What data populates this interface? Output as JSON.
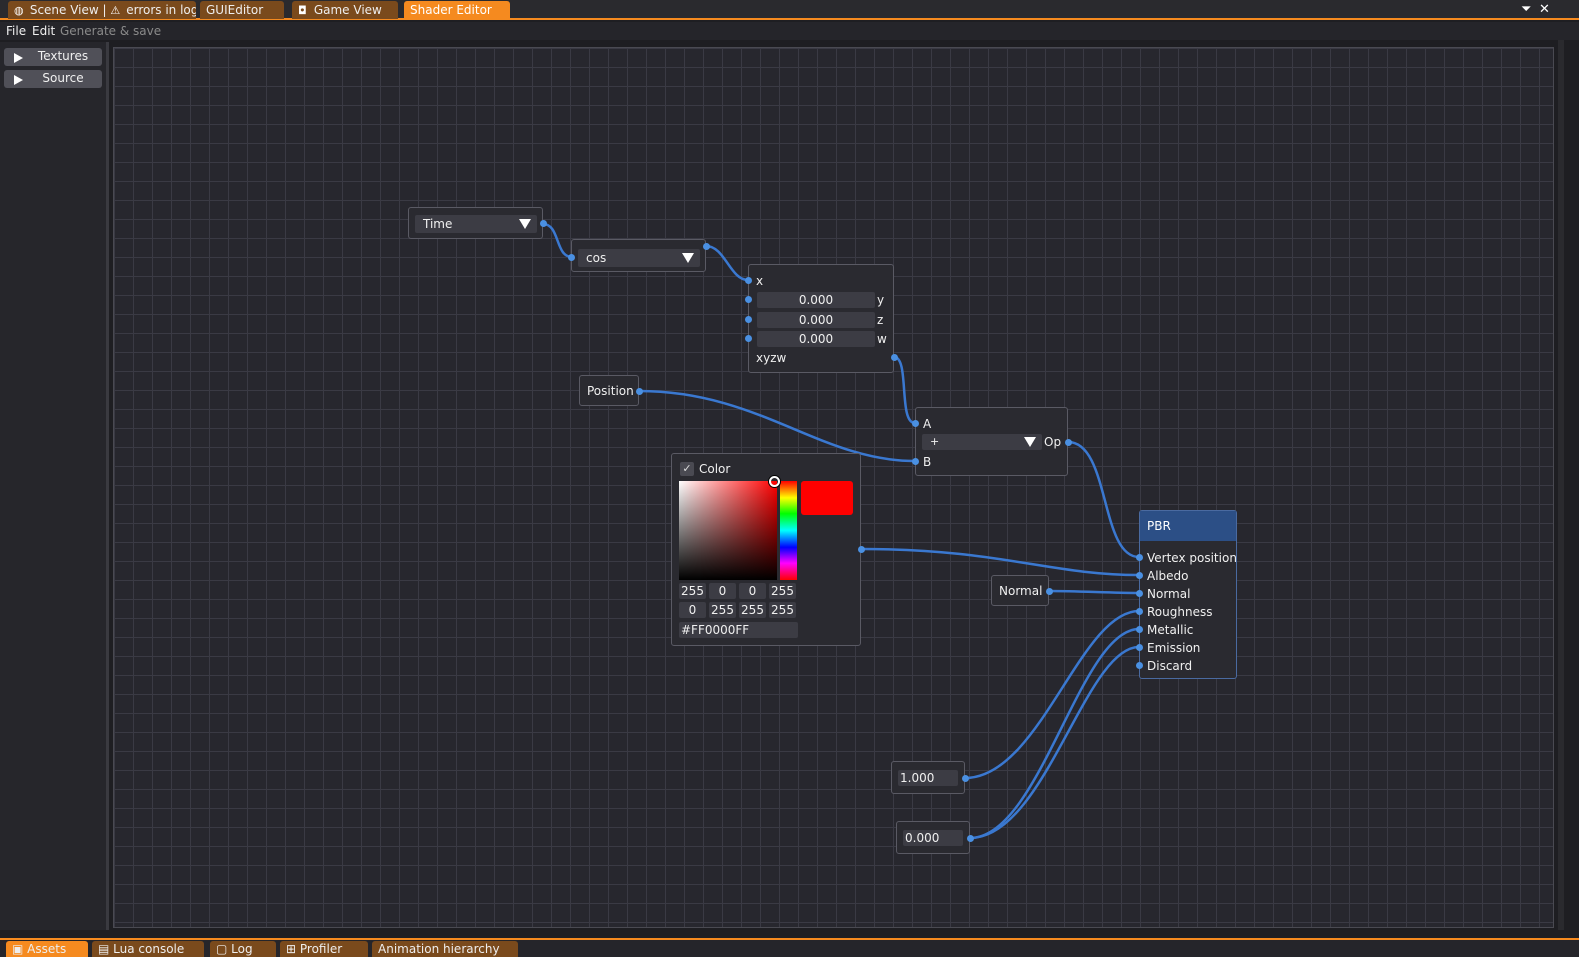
{
  "tabs": [
    {
      "label": "Scene View | ",
      "icon": "globe-icon"
    },
    {
      "label": "errors in log",
      "icon": "warning-icon"
    },
    {
      "label": "GUIEditor"
    },
    {
      "label": "Game View",
      "icon": "camera-icon"
    },
    {
      "label": "Shader Editor",
      "active": true
    }
  ],
  "menu": {
    "file": "File",
    "edit": "Edit",
    "generate": "Generate & save"
  },
  "sidebar": {
    "items": [
      {
        "label": "Textures"
      },
      {
        "label": "Source"
      }
    ]
  },
  "nodes": {
    "time": {
      "value": "Time"
    },
    "cos": {
      "value": "cos"
    },
    "vector": {
      "x_label": "x",
      "y_value": "0.000",
      "y_label": "y",
      "z_value": "0.000",
      "z_label": "z",
      "w_value": "0.000",
      "w_label": "w",
      "output_label": "xyzw"
    },
    "position": {
      "label": "Position"
    },
    "op": {
      "a_label": "A",
      "b_label": "B",
      "operator": "+",
      "output_label": "Op"
    },
    "color": {
      "label": "Color",
      "swatch_color": "#ff0000",
      "rgba": [
        "255",
        "0",
        "0",
        "255"
      ],
      "hsva": [
        "0",
        "255",
        "255",
        "255"
      ],
      "hex": "#FF0000FF"
    },
    "normal": {
      "label": "Normal"
    },
    "pbr": {
      "title": "PBR",
      "inputs": [
        "Vertex position",
        "Albedo",
        "Normal",
        "Roughness",
        "Metallic",
        "Emission",
        "Discard"
      ]
    },
    "float1": {
      "value": "1.000"
    },
    "float0": {
      "value": "0.000"
    }
  },
  "bottom_tabs": [
    {
      "label": "Assets",
      "active": true
    },
    {
      "label": "Lua console"
    },
    {
      "label": "Log"
    },
    {
      "label": "Profiler"
    },
    {
      "label": "Animation hierarchy"
    }
  ],
  "colors": {
    "accent": "#f58a1f",
    "wire": "#3a78d0",
    "pbr_header": "#2c4f86",
    "canvas": "#27272e"
  }
}
